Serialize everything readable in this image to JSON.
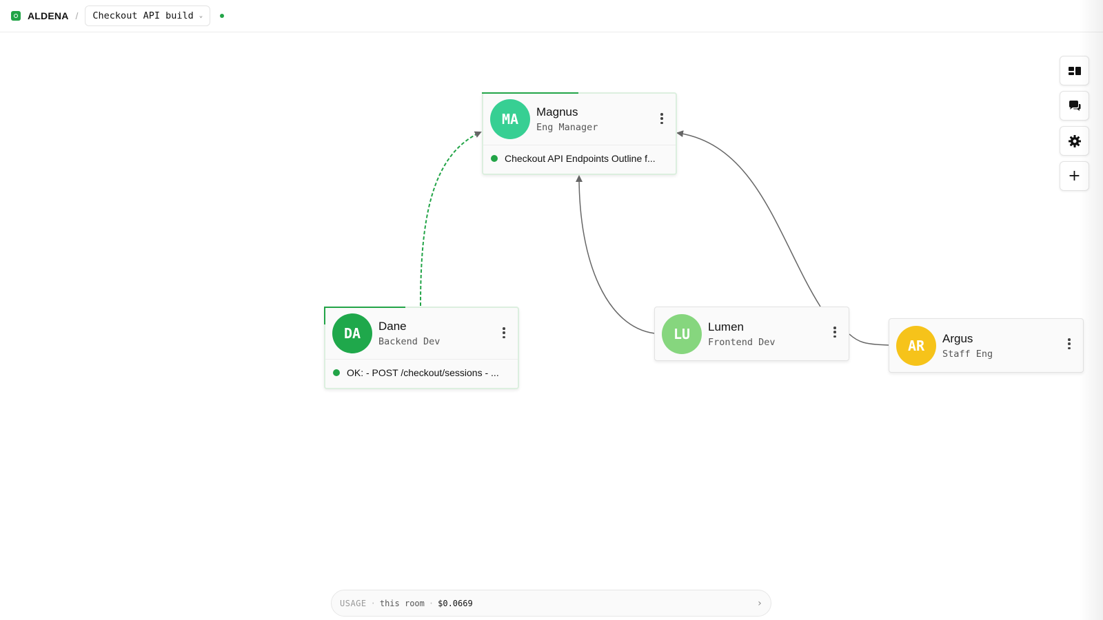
{
  "header": {
    "brand": "ALDENA",
    "separator": "/",
    "room_name": "Checkout API build",
    "room_chevron_icon": "chevron-down-icon",
    "status_color": "#22a447"
  },
  "nodes": [
    {
      "id": "magnus",
      "initials": "MA",
      "name": "Magnus",
      "role": "Eng Manager",
      "avatar_color": "#37cf93",
      "status_text": "Checkout API Endpoints Outline f...",
      "status_color": "#22a447"
    },
    {
      "id": "dane",
      "initials": "DA",
      "name": "Dane",
      "role": "Backend Dev",
      "avatar_color": "#1fa84b",
      "status_text": "OK: - POST /checkout/sessions - ...",
      "status_color": "#22a447"
    },
    {
      "id": "lumen",
      "initials": "LU",
      "name": "Lumen",
      "role": "Frontend Dev",
      "avatar_color": "#86d67e"
    },
    {
      "id": "argus",
      "initials": "AR",
      "name": "Argus",
      "role": "Staff Eng",
      "avatar_color": "#f6c31a"
    }
  ],
  "edges": [
    {
      "from": "dane",
      "to": "magnus",
      "style": "dashed",
      "color": "#22a447"
    },
    {
      "from": "lumen",
      "to": "magnus",
      "style": "solid",
      "color": "#666666"
    },
    {
      "from": "lumen",
      "to": "magnus",
      "style": "solid",
      "color": "#666666"
    },
    {
      "from": "argus",
      "to": "lumen",
      "style": "solid",
      "color": "#666666"
    }
  ],
  "toolbar": {
    "buttons": [
      {
        "name": "layout-icon"
      },
      {
        "name": "chat-icon"
      },
      {
        "name": "gear-icon"
      },
      {
        "name": "plus-icon",
        "glyph": "+"
      }
    ]
  },
  "usage": {
    "label": "USAGE",
    "separator": "·",
    "scope": "this room",
    "cost": "$0.0669",
    "arrow_icon": "chevron-right-icon",
    "arrow_glyph": "›"
  }
}
